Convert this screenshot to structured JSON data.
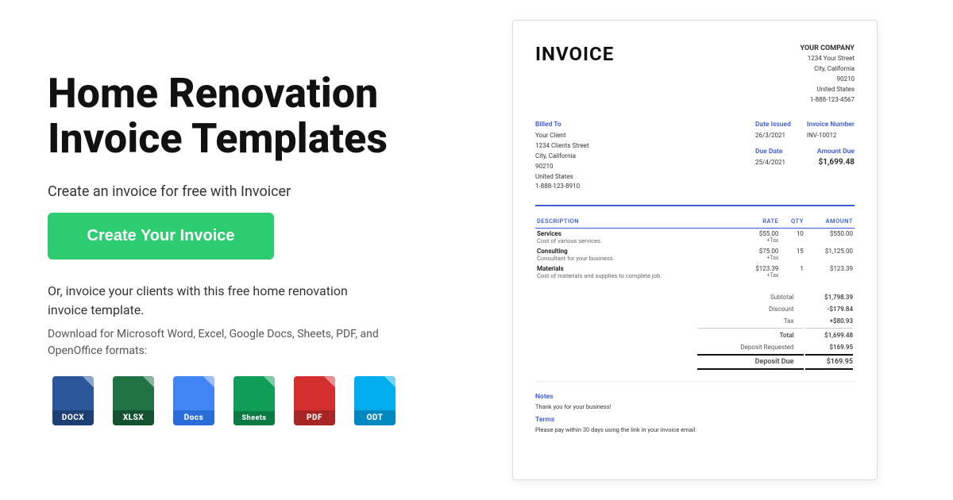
{
  "left": {
    "title_line1": "Home Renovation",
    "title_line2": "Invoice Templates",
    "subtitle": "Create an invoice for free with Invoicer",
    "cta_label": "Create Your Invoice",
    "alt_text": "Or, invoice your clients with this free home renovation invoice template.",
    "download_text": "Download for Microsoft Word, Excel, Google Docs, Sheets, PDF, and OpenOffice formats:",
    "formats": [
      {
        "id": "docx",
        "label": "DOCX",
        "color_top": "#2B579A",
        "color_bottom": "#1e3f73"
      },
      {
        "id": "xlsx",
        "label": "XLSX",
        "color_top": "#217346",
        "color_bottom": "#155230"
      },
      {
        "id": "gdocs",
        "label": "Docs",
        "color_top": "#4285F4",
        "color_bottom": "#2a6dd9"
      },
      {
        "id": "gsheets",
        "label": "Sheets",
        "color_top": "#0F9D58",
        "color_bottom": "#0b7a43"
      },
      {
        "id": "pdf",
        "label": "PDF",
        "color_top": "#d32f2f",
        "color_bottom": "#a82525"
      },
      {
        "id": "odt",
        "label": "ODT",
        "color_top": "#00adef",
        "color_bottom": "#0088c0"
      }
    ]
  },
  "invoice": {
    "title": "INVOICE",
    "company_name": "YOUR COMPANY",
    "company_address": "1234 Your Street\nCity, California\n90210\nUnited States\n1-888-123-4567",
    "billed_to_label": "Billed To",
    "billed_to_name": "Your Client",
    "billed_to_address": "1234 Clients Street\nCity, California\n90210\nUnited States\n1-888-123-8910",
    "date_issued_label": "Date Issued",
    "date_issued_value": "26/3/2021",
    "invoice_number_label": "Invoice Number",
    "invoice_number_value": "INV-10012",
    "amount_due_label": "Amount Due",
    "amount_due_value": "$1,699.48",
    "due_date_label": "Due Date",
    "due_date_value": "25/4/2021",
    "table_headers": [
      "DESCRIPTION",
      "RATE",
      "QTY",
      "AMOUNT"
    ],
    "line_items": [
      {
        "name": "Services",
        "desc": "Cost of various services.",
        "rate": "$55.00",
        "tax": "+Tax",
        "qty": "10",
        "amount": "$550.00"
      },
      {
        "name": "Consulting",
        "desc": "Consultant for your business.",
        "rate": "$75.00",
        "tax": "+Tax",
        "qty": "15",
        "amount": "$1,125.00"
      },
      {
        "name": "Materials",
        "desc": "Cost of materials and supplies to complete job.",
        "rate": "$123.39",
        "tax": "+Tax",
        "qty": "1",
        "amount": "$123.39"
      }
    ],
    "subtotal_label": "Subtotal",
    "subtotal_value": "$1,798.39",
    "discount_label": "Discount",
    "discount_value": "-$179.84",
    "tax_label": "Tax",
    "tax_value": "+$80.93",
    "total_label": "Total",
    "total_value": "$1,699.48",
    "deposit_requested_label": "Deposit Requested",
    "deposit_requested_value": "$169.95",
    "deposit_due_label": "Deposit Due",
    "deposit_due_value": "$169.95",
    "notes_label": "Notes",
    "notes_value": "Thank you for your business!",
    "terms_label": "Terms",
    "terms_value": "Please pay within 30 days using the link in your invoice email."
  }
}
